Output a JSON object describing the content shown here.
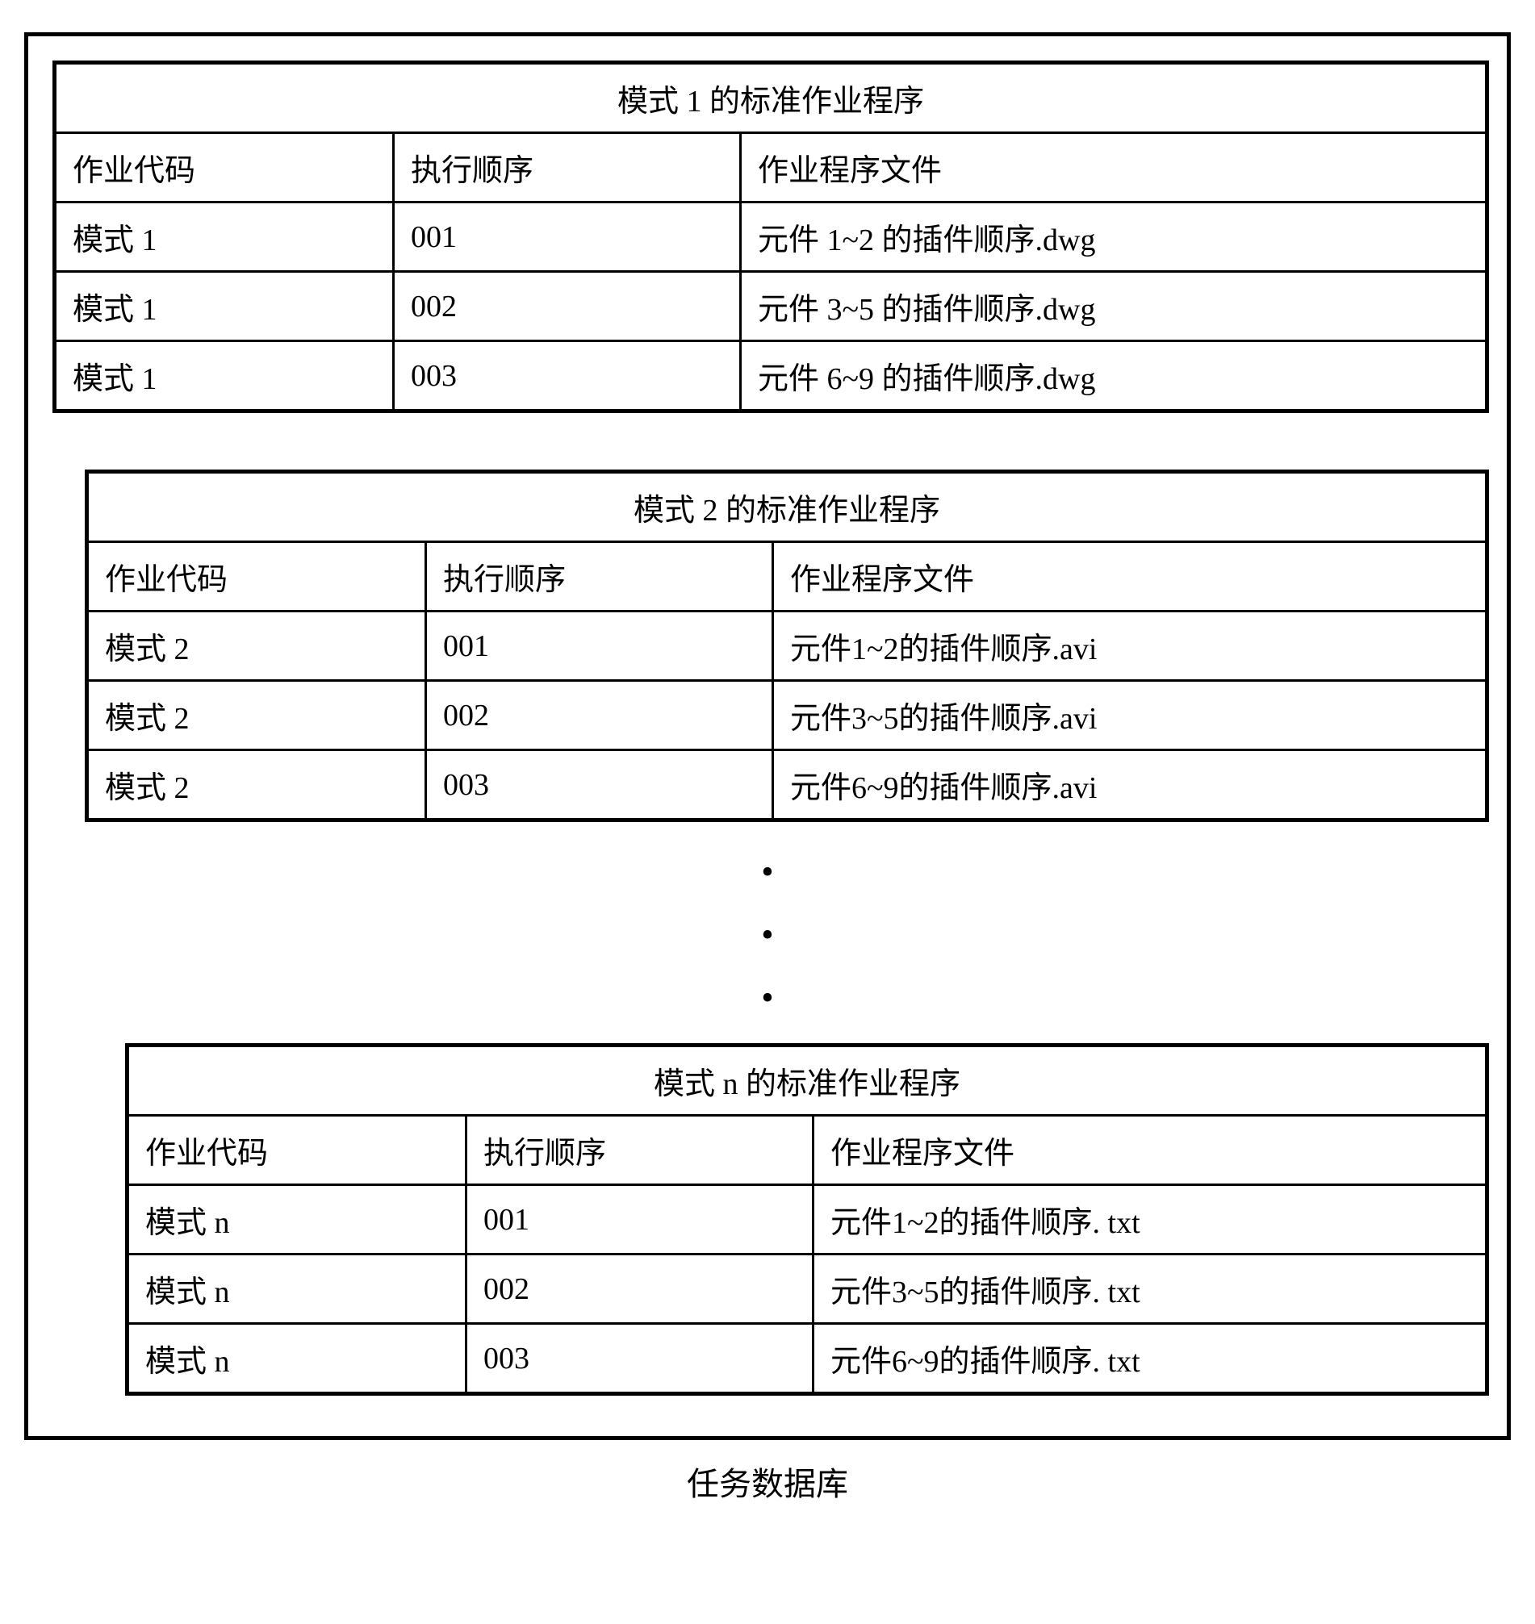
{
  "caption": "任务数据库",
  "headers": {
    "col1": "作业代码",
    "col2": "执行顺序",
    "col3": "作业程序文件"
  },
  "tables": [
    {
      "title": "模式 1 的标准作业程序",
      "rows": [
        {
          "code": "模式 1",
          "order": "001",
          "file": "元件 1~2 的插件顺序.dwg"
        },
        {
          "code": "模式 1",
          "order": "002",
          "file": "元件 3~5 的插件顺序.dwg"
        },
        {
          "code": "模式 1",
          "order": "003",
          "file": "元件 6~9 的插件顺序.dwg"
        }
      ]
    },
    {
      "title": "模式 2 的标准作业程序",
      "rows": [
        {
          "code": "模式  2",
          "order": "001",
          "file": "元件1~2的插件顺序.avi"
        },
        {
          "code": "模式  2",
          "order": "002",
          "file": "元件3~5的插件顺序.avi"
        },
        {
          "code": "模式  2",
          "order": "003",
          "file": "元件6~9的插件顺序.avi"
        }
      ]
    },
    {
      "title": "模式 n 的标准作业程序",
      "rows": [
        {
          "code": "模式 n",
          "order": "001",
          "file": "元件1~2的插件顺序. txt"
        },
        {
          "code": "模式 n",
          "order": "002",
          "file": "元件3~5的插件顺序. txt"
        },
        {
          "code": "模式 n",
          "order": "003",
          "file": "元件6~9的插件顺序. txt"
        }
      ]
    }
  ]
}
